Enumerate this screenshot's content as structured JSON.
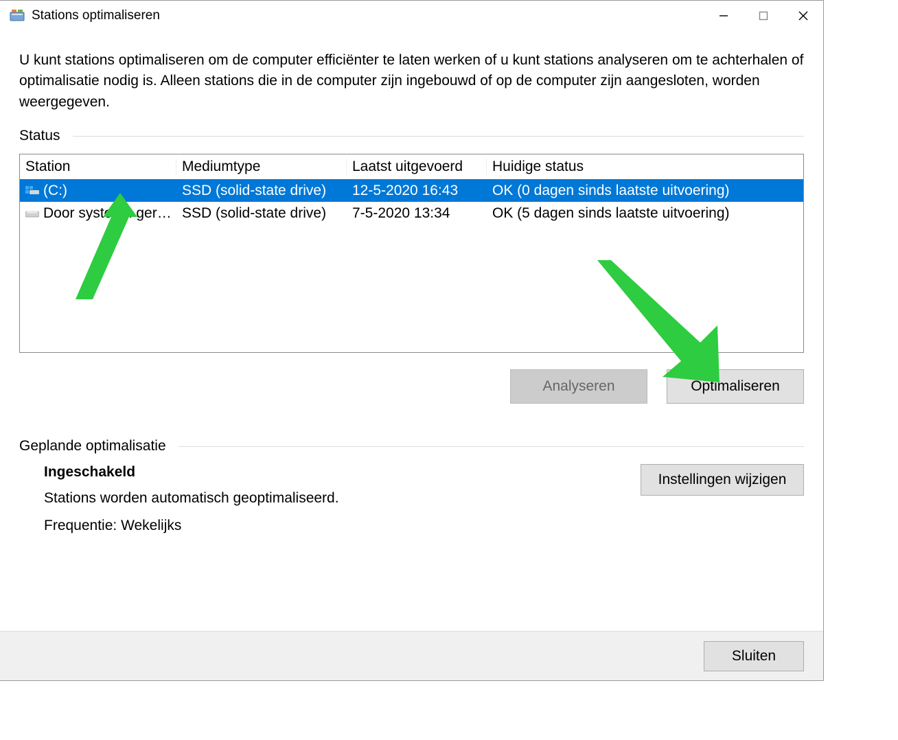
{
  "window": {
    "title": "Stations optimaliseren"
  },
  "intro": "U kunt stations optimaliseren om de computer efficiënter te laten werken of u kunt stations analyseren om te achterhalen of optimalisatie nodig is. Alleen stations die in de computer zijn ingebouwd of op de computer zijn aangesloten, worden weergegeven.",
  "status_section": {
    "label": "Status",
    "columns": {
      "station": "Station",
      "medium": "Mediumtype",
      "last": "Laatst uitgevoerd",
      "current": "Huidige status"
    },
    "rows": [
      {
        "station": "(C:)",
        "medium": "SSD (solid-state drive)",
        "last": "12-5-2020 16:43",
        "current": "OK (0 dagen sinds laatste uitvoering)",
        "selected": true,
        "icon": "windows-drive-icon"
      },
      {
        "station": "Door systeem ger…",
        "medium": "SSD (solid-state drive)",
        "last": "7-5-2020 13:34",
        "current": "OK (5 dagen sinds laatste uitvoering)",
        "selected": false,
        "icon": "drive-icon"
      }
    ]
  },
  "actions": {
    "analyze": "Analyseren",
    "optimize": "Optimaliseren"
  },
  "scheduled": {
    "label": "Geplande optimalisatie",
    "state": "Ingeschakeld",
    "desc": "Stations worden automatisch geoptimaliseerd.",
    "freq": "Frequentie: Wekelijks",
    "settings_btn": "Instellingen wijzigen"
  },
  "footer": {
    "close": "Sluiten"
  }
}
